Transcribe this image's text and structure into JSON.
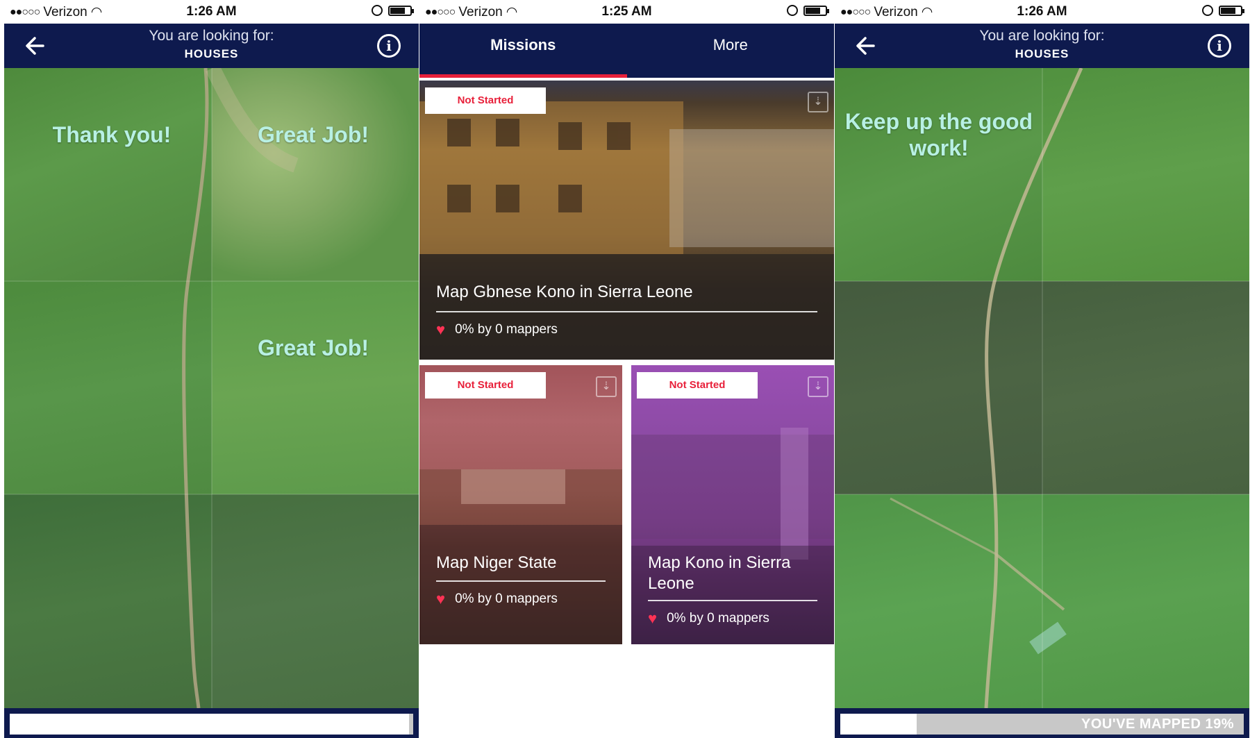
{
  "status_bars": [
    {
      "carrier": "Verizon",
      "time": "1:26 AM"
    },
    {
      "carrier": "Verizon",
      "time": "1:25 AM"
    },
    {
      "carrier": "Verizon",
      "time": "1:26 AM"
    }
  ],
  "screen1": {
    "header_line1": "You are looking for:",
    "header_line2": "HOUSES",
    "messages": [
      "Thank you!",
      "Great Job!",
      "Great Job!"
    ],
    "progress_fraction": 0.99
  },
  "screen2": {
    "tabs": [
      {
        "label": "Missions"
      },
      {
        "label": "More"
      }
    ],
    "missions": [
      {
        "status": "Not Started",
        "title": "Map Gbnese Kono in Sierra Leone",
        "stats": "0% by 0 mappers"
      },
      {
        "status": "Not Started",
        "title": "Map Niger State",
        "stats": "0% by 0 mappers"
      },
      {
        "status": "Not Started",
        "title": "Map Kono in Sierra Leone",
        "stats": "0% by 0 mappers"
      }
    ]
  },
  "screen3": {
    "header_line1": "You are looking for:",
    "header_line2": "HOUSES",
    "message": "Keep up the good work!",
    "progress_label": "YOU'VE MAPPED 19%",
    "progress_fraction": 0.19
  },
  "colors": {
    "navy": "#0e1a4e",
    "accent_red": "#e8203a",
    "message_text": "#b8f0e4"
  }
}
